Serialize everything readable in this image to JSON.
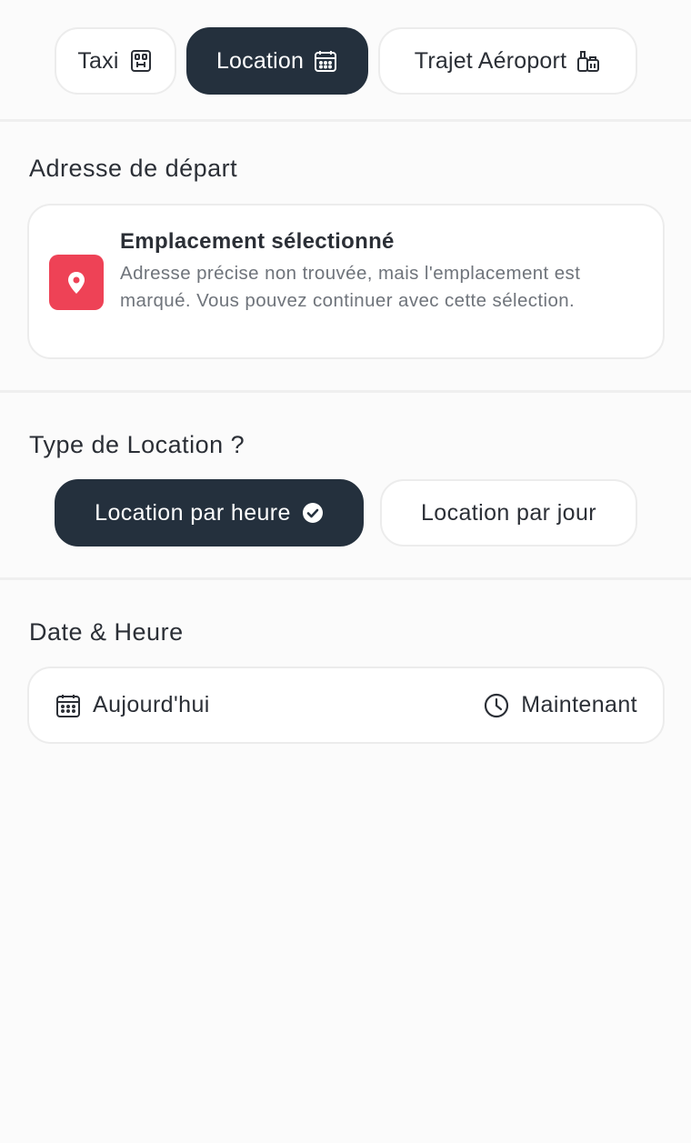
{
  "tabs": [
    {
      "label": "Taxi",
      "icon": "taxi-icon",
      "active": false
    },
    {
      "label": "Location",
      "icon": "calendar-icon",
      "active": true
    },
    {
      "label": "Trajet Aéroport",
      "icon": "luggage-icon",
      "active": false
    }
  ],
  "departure": {
    "heading": "Adresse de départ",
    "card_title": "Emplacement sélectionné",
    "card_description": "Adresse précise non trouvée, mais l'emplacement est marqué. Vous pouvez continuer avec cette sélection.",
    "icon": "location-pin-icon"
  },
  "rental_type": {
    "heading": "Type de Location ?",
    "options": [
      {
        "label": "Location par heure",
        "selected": true,
        "icon": "check-circle-icon"
      },
      {
        "label": "Location par jour",
        "selected": false
      }
    ]
  },
  "datetime": {
    "heading": "Date & Heure",
    "date_label": "Aujourd'hui",
    "date_icon": "calendar-icon",
    "time_label": "Maintenant",
    "time_icon": "clock-icon"
  },
  "colors": {
    "active_dark": "#24303d",
    "pin_red": "#ee4256",
    "text": "#2b2f36",
    "muted_text": "#6f747b",
    "border": "#ececec",
    "background": "#fbfbfb"
  }
}
